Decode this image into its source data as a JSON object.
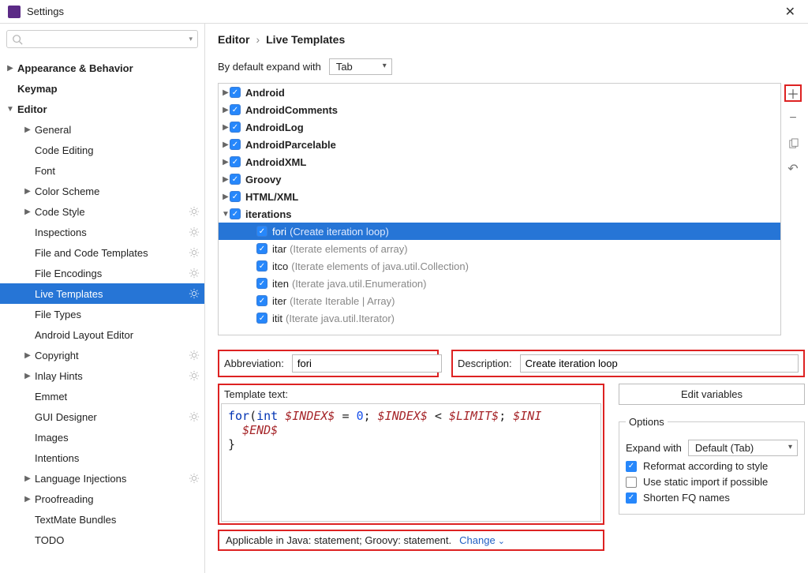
{
  "title": "Settings",
  "search": {
    "placeholder": ""
  },
  "sidebar": [
    {
      "label": "Appearance & Behavior",
      "indent": 0,
      "tri": "▶",
      "bold": true,
      "gear": false
    },
    {
      "label": "Keymap",
      "indent": 0,
      "tri": "",
      "bold": true,
      "gear": false
    },
    {
      "label": "Editor",
      "indent": 0,
      "tri": "▼",
      "bold": true,
      "gear": false
    },
    {
      "label": "General",
      "indent": 1,
      "tri": "▶",
      "bold": false,
      "gear": false
    },
    {
      "label": "Code Editing",
      "indent": 1,
      "tri": "",
      "bold": false,
      "gear": false
    },
    {
      "label": "Font",
      "indent": 1,
      "tri": "",
      "bold": false,
      "gear": false
    },
    {
      "label": "Color Scheme",
      "indent": 1,
      "tri": "▶",
      "bold": false,
      "gear": false
    },
    {
      "label": "Code Style",
      "indent": 1,
      "tri": "▶",
      "bold": false,
      "gear": true
    },
    {
      "label": "Inspections",
      "indent": 1,
      "tri": "",
      "bold": false,
      "gear": true
    },
    {
      "label": "File and Code Templates",
      "indent": 1,
      "tri": "",
      "bold": false,
      "gear": true
    },
    {
      "label": "File Encodings",
      "indent": 1,
      "tri": "",
      "bold": false,
      "gear": true
    },
    {
      "label": "Live Templates",
      "indent": 1,
      "tri": "",
      "bold": false,
      "gear": true,
      "sel": true
    },
    {
      "label": "File Types",
      "indent": 1,
      "tri": "",
      "bold": false,
      "gear": false
    },
    {
      "label": "Android Layout Editor",
      "indent": 1,
      "tri": "",
      "bold": false,
      "gear": false
    },
    {
      "label": "Copyright",
      "indent": 1,
      "tri": "▶",
      "bold": false,
      "gear": true
    },
    {
      "label": "Inlay Hints",
      "indent": 1,
      "tri": "▶",
      "bold": false,
      "gear": true
    },
    {
      "label": "Emmet",
      "indent": 1,
      "tri": "",
      "bold": false,
      "gear": false
    },
    {
      "label": "GUI Designer",
      "indent": 1,
      "tri": "",
      "bold": false,
      "gear": true
    },
    {
      "label": "Images",
      "indent": 1,
      "tri": "",
      "bold": false,
      "gear": false
    },
    {
      "label": "Intentions",
      "indent": 1,
      "tri": "",
      "bold": false,
      "gear": false
    },
    {
      "label": "Language Injections",
      "indent": 1,
      "tri": "▶",
      "bold": false,
      "gear": true
    },
    {
      "label": "Proofreading",
      "indent": 1,
      "tri": "▶",
      "bold": false,
      "gear": false
    },
    {
      "label": "TextMate Bundles",
      "indent": 1,
      "tri": "",
      "bold": false,
      "gear": false
    },
    {
      "label": "TODO",
      "indent": 1,
      "tri": "",
      "bold": false,
      "gear": false
    }
  ],
  "breadcrumb": {
    "a": "Editor",
    "b": "Live Templates"
  },
  "expand": {
    "label": "By default expand with",
    "value": "Tab"
  },
  "templates": [
    {
      "indent": 0,
      "tri": "▶",
      "name": "Android"
    },
    {
      "indent": 0,
      "tri": "▶",
      "name": "AndroidComments"
    },
    {
      "indent": 0,
      "tri": "▶",
      "name": "AndroidLog"
    },
    {
      "indent": 0,
      "tri": "▶",
      "name": "AndroidParcelable"
    },
    {
      "indent": 0,
      "tri": "▶",
      "name": "AndroidXML"
    },
    {
      "indent": 0,
      "tri": "▶",
      "name": "Groovy"
    },
    {
      "indent": 0,
      "tri": "▶",
      "name": "HTML/XML"
    },
    {
      "indent": 0,
      "tri": "▼",
      "name": "iterations"
    },
    {
      "indent": 1,
      "tri": "",
      "name": "fori",
      "desc": "(Create iteration loop)",
      "sel": true
    },
    {
      "indent": 1,
      "tri": "",
      "name": "itar",
      "desc": "(Iterate elements of array)"
    },
    {
      "indent": 1,
      "tri": "",
      "name": "itco",
      "desc": "(Iterate elements of java.util.Collection)"
    },
    {
      "indent": 1,
      "tri": "",
      "name": "iten",
      "desc": "(Iterate java.util.Enumeration)"
    },
    {
      "indent": 1,
      "tri": "",
      "name": "iter",
      "desc": "(Iterate Iterable | Array)"
    },
    {
      "indent": 1,
      "tri": "",
      "name": "itit",
      "desc": "(Iterate java.util.Iterator)"
    }
  ],
  "abbr": {
    "label": "Abbreviation:",
    "value": "fori"
  },
  "desc": {
    "label": "Description:",
    "value": "Create iteration loop"
  },
  "template_text_label": "Template text:",
  "edit_vars": "Edit variables",
  "options": {
    "legend": "Options",
    "expand_label": "Expand with",
    "expand_value": "Default (Tab)",
    "reformat": "Reformat according to style",
    "static_import": "Use static import if possible",
    "shorten": "Shorten FQ names"
  },
  "applicable": "Applicable in Java: statement; Groovy: statement.",
  "change": "Change"
}
